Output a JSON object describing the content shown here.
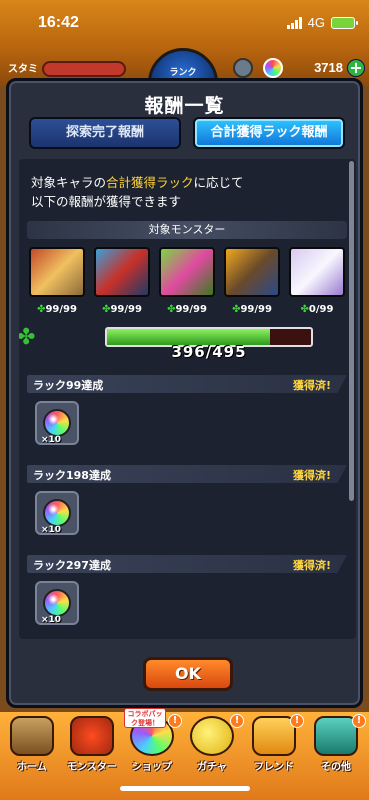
{
  "status_bar": {
    "time": "16:42",
    "network": "4G"
  },
  "top_bar": {
    "stamina_label": "スタミ",
    "rank_label": "ランク",
    "orb_count": "3718",
    "plus_label": "+"
  },
  "modal": {
    "title": "報酬一覧",
    "tabs": [
      {
        "label": "探索完了報酬",
        "selected": false
      },
      {
        "label": "合計獲得ラック報酬",
        "selected": true
      }
    ],
    "description_line1_pre": "対象キャラの",
    "description_line1_highlight": "合計獲得ラック",
    "description_line1_post": "に応じて",
    "description_line2": "以下の報酬が獲得できます",
    "target_header": "対象モンスター",
    "monsters": [
      {
        "luck": "99/99"
      },
      {
        "luck": "99/99"
      },
      {
        "luck": "99/99"
      },
      {
        "luck": "99/99"
      },
      {
        "luck": "0/99"
      }
    ],
    "progress": {
      "text": "396/495",
      "current": 396,
      "max": 495
    },
    "rewards": [
      {
        "name": "ラック99達成",
        "status": "獲得済!",
        "quantity": "×10"
      },
      {
        "name": "ラック198達成",
        "status": "獲得済!",
        "quantity": "×10"
      },
      {
        "name": "ラック297達成",
        "status": "獲得済!",
        "quantity": "×10"
      }
    ],
    "ok_label": "OK"
  },
  "bottom_nav": {
    "items": [
      {
        "label": "ホーム"
      },
      {
        "label": "モンスター"
      },
      {
        "label": "ショップ"
      },
      {
        "label": "ガチャ"
      },
      {
        "label": "フレンド"
      },
      {
        "label": "その他"
      }
    ],
    "collab_tag": "コラボパック登場！",
    "alert": "!"
  },
  "colors": {
    "highlight": "#ffd43a",
    "clover_green": "#3ed43a",
    "ok_orange": "#ff8a2a"
  }
}
